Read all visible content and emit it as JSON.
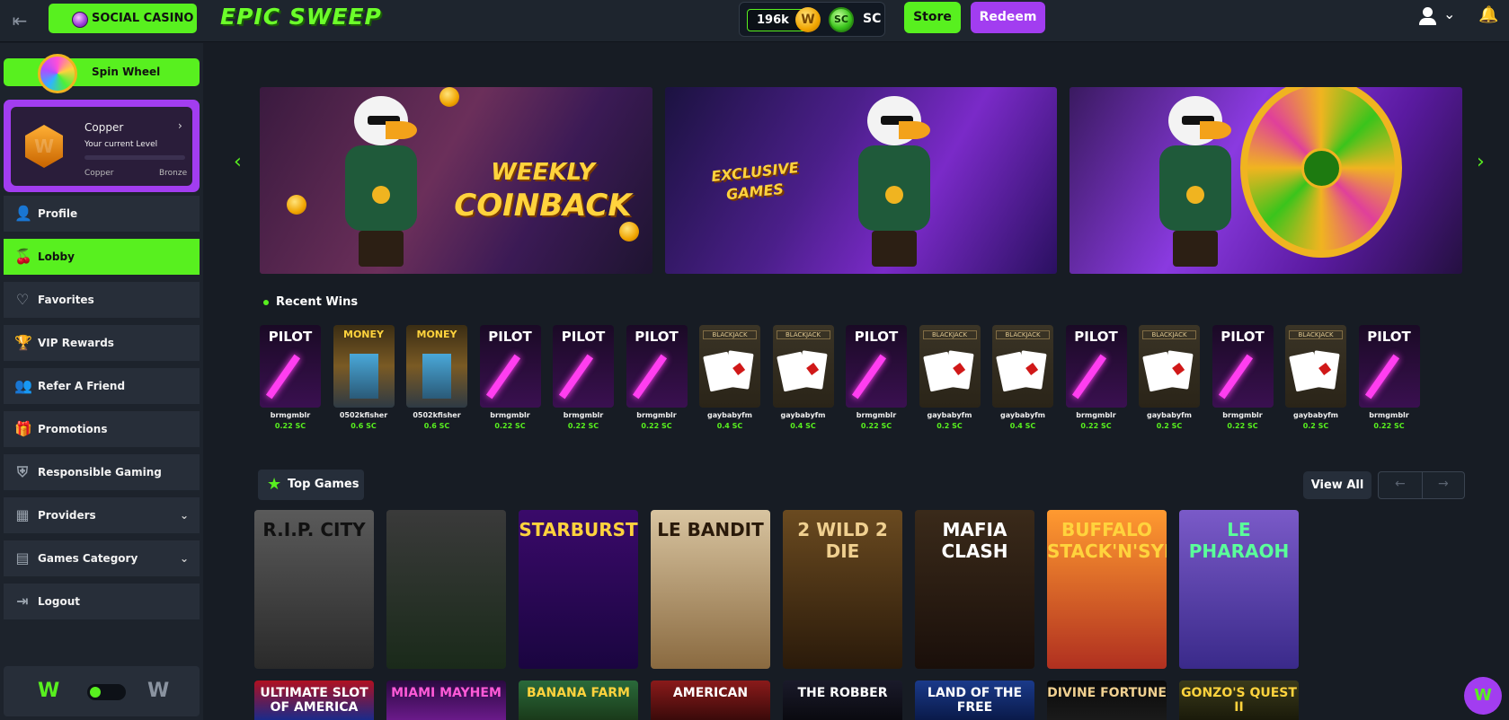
{
  "header": {
    "social_casino_label": "SOCIAL CASINO",
    "logo_text": "EPIC SWEEP",
    "gc_balance": "196k",
    "gc_coin_label": "W",
    "sc_coin_label": "SC",
    "sc_label": "SC",
    "store_label": "Store",
    "redeem_label": "Redeem"
  },
  "sidebar": {
    "spin_wheel_label": "Spin Wheel",
    "level": {
      "name": "Copper",
      "caption": "Your current Level",
      "from": "Copper",
      "to": "Bronze",
      "badge_letter": "W"
    },
    "nav": [
      {
        "label": "Profile",
        "icon": "user-icon"
      },
      {
        "label": "Lobby",
        "icon": "cherries-icon"
      },
      {
        "label": "Favorites",
        "icon": "heart-icon"
      },
      {
        "label": "VIP Rewards",
        "icon": "trophy-icon"
      },
      {
        "label": "Refer A Friend",
        "icon": "users-icon"
      },
      {
        "label": "Promotions",
        "icon": "gift-icon"
      },
      {
        "label": "Responsible Gaming",
        "icon": "shield-icon"
      },
      {
        "label": "Providers",
        "icon": "providers-icon"
      },
      {
        "label": "Games Category",
        "icon": "category-icon"
      },
      {
        "label": "Logout",
        "icon": "logout-icon"
      }
    ],
    "theme_light_glyph": "W",
    "theme_dark_glyph": "W"
  },
  "banners": [
    {
      "title_line1": "WEEKLY",
      "title_line2": "COINBACK"
    },
    {
      "title_line1": "EXCLUSIVE",
      "title_line2": "GAMES"
    },
    {
      "title_line1": "",
      "title_line2": ""
    }
  ],
  "recent_wins": {
    "title": "Recent Wins",
    "items": [
      {
        "game": "PILOT",
        "user": "brmgmblr",
        "amount": "0.22 SC"
      },
      {
        "game": "MONEY",
        "user": "0502kfisher",
        "amount": "0.6 SC"
      },
      {
        "game": "MONEY",
        "user": "0502kfisher",
        "amount": "0.6 SC"
      },
      {
        "game": "PILOT",
        "user": "brmgmblr",
        "amount": "0.22 SC"
      },
      {
        "game": "PILOT",
        "user": "brmgmblr",
        "amount": "0.22 SC"
      },
      {
        "game": "PILOT",
        "user": "brmgmblr",
        "amount": "0.22 SC"
      },
      {
        "game": "BLACKJACK",
        "user": "gaybabyfm",
        "amount": "0.4 SC"
      },
      {
        "game": "BLACKJACK",
        "user": "gaybabyfm",
        "amount": "0.4 SC"
      },
      {
        "game": "PILOT",
        "user": "brmgmblr",
        "amount": "0.22 SC"
      },
      {
        "game": "BLACKJACK",
        "user": "gaybabyfm",
        "amount": "0.2 SC"
      },
      {
        "game": "BLACKJACK",
        "user": "gaybabyfm",
        "amount": "0.4 SC"
      },
      {
        "game": "PILOT",
        "user": "brmgmblr",
        "amount": "0.22 SC"
      },
      {
        "game": "BLACKJACK",
        "user": "gaybabyfm",
        "amount": "0.2 SC"
      },
      {
        "game": "PILOT",
        "user": "brmgmblr",
        "amount": "0.22 SC"
      },
      {
        "game": "BLACKJACK",
        "user": "gaybabyfm",
        "amount": "0.2 SC"
      },
      {
        "game": "PILOT",
        "user": "brmgmblr",
        "amount": "0.22 SC"
      }
    ]
  },
  "top_games": {
    "title": "Top Games",
    "view_all_label": "View All",
    "prev_label": "←",
    "next_label": "→",
    "row1": [
      {
        "title": "R.I.P. CITY"
      },
      {
        "title": ""
      },
      {
        "title": "STARBURST"
      },
      {
        "title": "LE BANDIT"
      },
      {
        "title": "2 WILD 2 DIE"
      },
      {
        "title": "MAFIA CLASH"
      },
      {
        "title": "BUFFALO STACK'N'SYNC"
      },
      {
        "title": "LE PHARAOH"
      }
    ],
    "row2": [
      {
        "title": "ULTIMATE SLOT OF AMERICA"
      },
      {
        "title": "MIAMI MAYHEM"
      },
      {
        "title": "BANANA FARM"
      },
      {
        "title": "AMERICAN"
      },
      {
        "title": "THE ROBBER"
      },
      {
        "title": "LAND OF THE FREE"
      },
      {
        "title": "DIVINE FORTUNE"
      },
      {
        "title": "GONZO'S QUEST II"
      }
    ]
  },
  "fab_glyph": "W",
  "colors": {
    "accent_green": "#58f01f",
    "accent_purple": "#a23df0",
    "background": "#171c24"
  }
}
